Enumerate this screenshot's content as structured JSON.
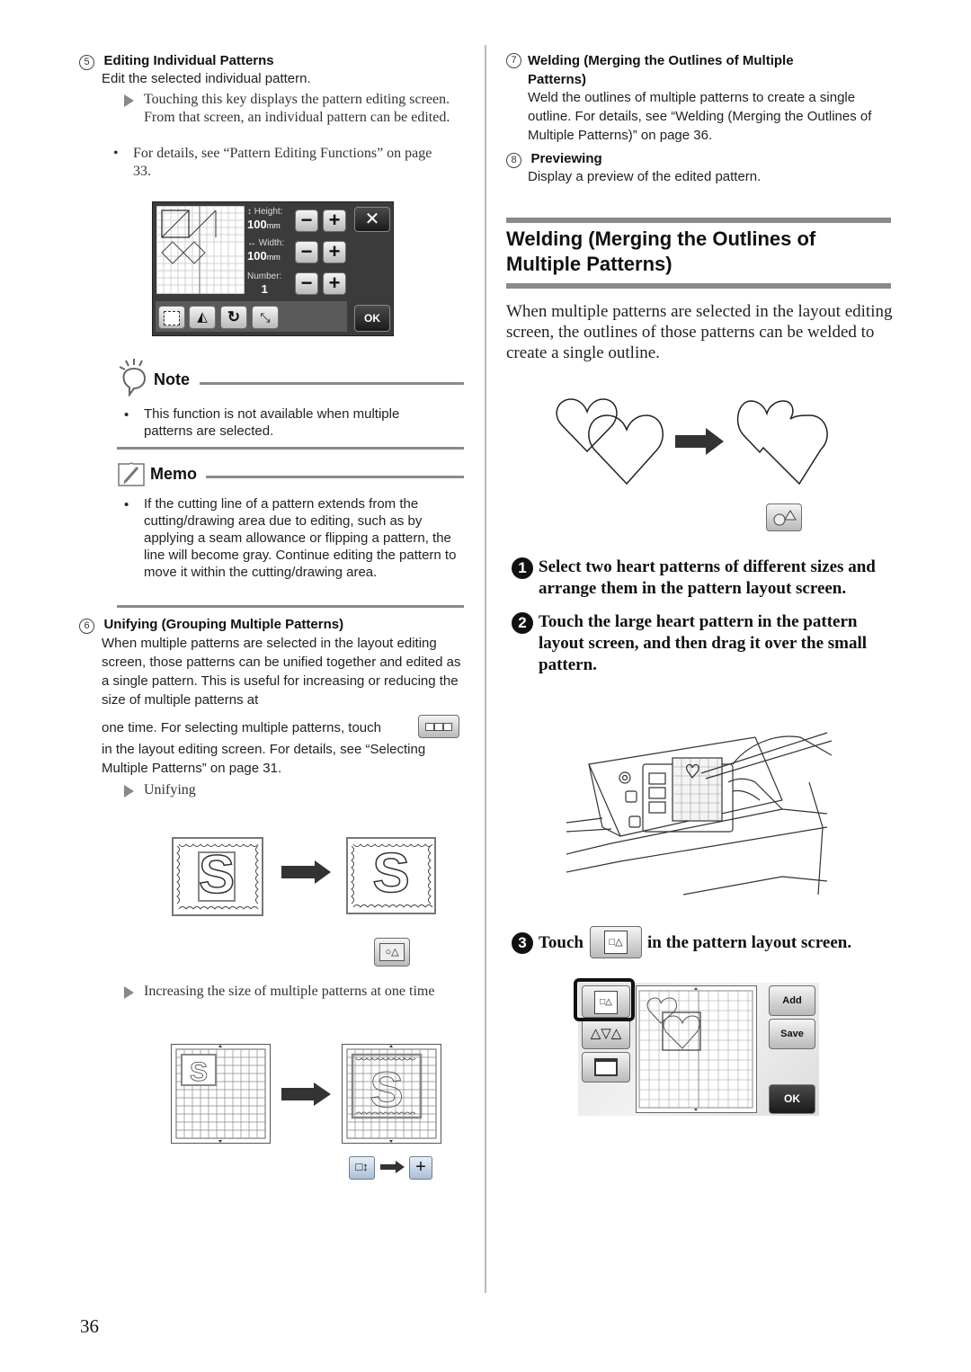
{
  "left": {
    "item5": {
      "num": "5",
      "title": "Editing Individual Patterns",
      "desc": "Edit the selected individual pattern.",
      "arrow_text": "Touching this key displays the pattern editing screen. From that screen, an individual pattern can be edited.",
      "bullet": "For details, see “Pattern Editing Functions” on page 33."
    },
    "edit_screen": {
      "height_label": "↕ Height:",
      "height_value": "100",
      "width_label": "↔ Width:",
      "width_value": "100",
      "unit": "mm",
      "number_label": "Number:",
      "number_value": "1",
      "minus": "−",
      "plus": "+",
      "close": "✕",
      "ok": "OK"
    },
    "note": {
      "title": "Note",
      "bullet": "This function is not available when multiple patterns are selected."
    },
    "memo": {
      "title": "Memo",
      "bullet": "If the cutting line of a pattern extends from the cutting/drawing area due to editing, such as by applying a seam allowance or flipping a pattern, the line will become gray. Continue editing the pattern to move it within the cutting/drawing area."
    },
    "item6": {
      "num": "6",
      "title": "Unifying (Grouping Multiple Patterns)",
      "desc_part1": "When multiple patterns are selected in the layout editing screen, those patterns can be unified together and edited as a single pattern. This is useful for increasing or reducing the size of multiple patterns at",
      "desc_part2": "one time. For selecting multiple patterns, touch",
      "desc_part3": "in the layout editing screen. For details, see “Selecting Multiple Patterns” on page 31.",
      "arrow1": "Unifying",
      "stamp_letter": "S",
      "arrow2": "Increasing the size of multiple patterns at one time"
    }
  },
  "right": {
    "item7": {
      "num": "7",
      "title": "Welding (Merging the Outlines of Multiple Patterns)",
      "desc": "Weld the outlines of multiple patterns to create a single outline. For details, see “Welding (Merging the Outlines of Multiple Patterns)” on page 36."
    },
    "item8": {
      "num": "8",
      "title": "Previewing",
      "desc": "Display a preview of the edited pattern."
    },
    "section": {
      "title": "Welding (Merging the Outlines of Multiple Patterns)",
      "intro": "When multiple patterns are selected in the layout editing screen, the outlines of those patterns can be welded to create a single outline."
    },
    "steps": [
      {
        "num": "1",
        "text": "Select two heart patterns of different sizes and arrange them in the pattern layout screen."
      },
      {
        "num": "2",
        "text": "Touch the large heart pattern in the pattern layout screen, and then drag it over the small pattern."
      },
      {
        "num": "3",
        "text_before": "Touch",
        "text_after": "in the pattern layout screen."
      }
    ],
    "layout_screen": {
      "add": "Add",
      "save": "Save",
      "ok": "OK"
    }
  },
  "footer": {
    "page_number": "36"
  }
}
